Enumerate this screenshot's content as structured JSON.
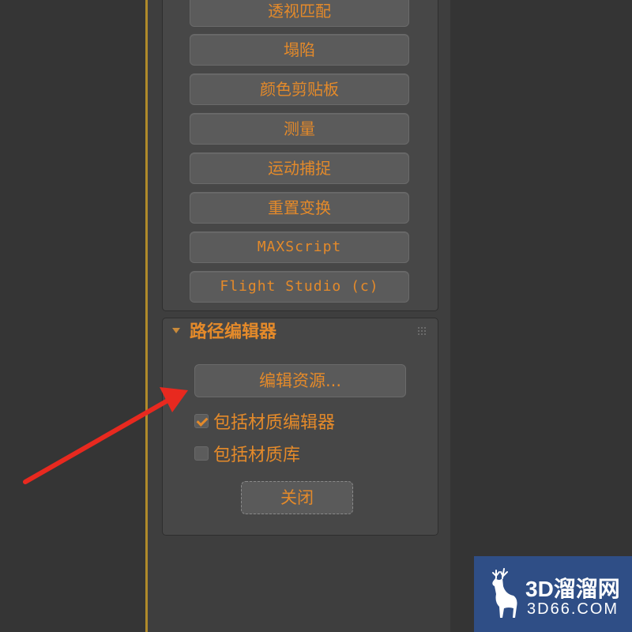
{
  "utilities": {
    "buttons": [
      {
        "label": "透视匹配"
      },
      {
        "label": "塌陷"
      },
      {
        "label": "颜色剪贴板"
      },
      {
        "label": "测量"
      },
      {
        "label": "运动捕捉"
      },
      {
        "label": "重置变换"
      },
      {
        "label": "MAXScript"
      },
      {
        "label": "Flight Studio (c)"
      }
    ]
  },
  "path_editor": {
    "title": "路径编辑器",
    "edit_resources_label": "编辑资源...",
    "include_material_editor": {
      "label": "包括材质编辑器",
      "checked": true
    },
    "include_material_library": {
      "label": "包括材质库",
      "checked": false
    },
    "close_label": "关闭"
  },
  "watermark": {
    "title": "3D溜溜网",
    "subtitle": "3D66.COM"
  },
  "colors": {
    "accent": "#e48a2a",
    "annotation_arrow": "#e8291f",
    "watermark_bg": "#2f4e86"
  }
}
